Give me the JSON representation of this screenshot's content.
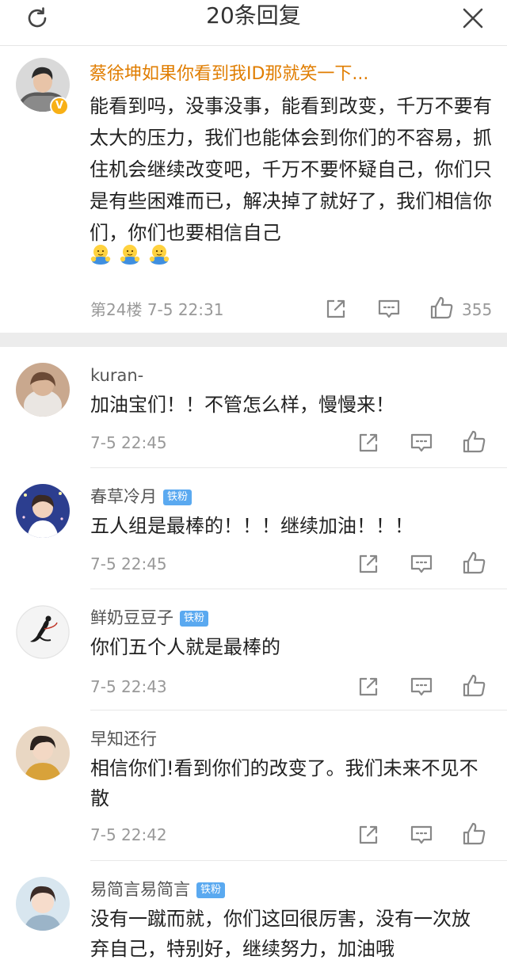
{
  "header": {
    "title": "20条回复"
  },
  "main_comment": {
    "username": "蔡徐坤如果你看到我ID那就笑一下...",
    "verified": "V",
    "text": "能看到吗，没事没事，能看到改变，千万不要有太大的压力，我们也能体会到你们的不容易，抓住机会继续改变吧，千万不要怀疑自己，你们只是有些困难而已，解决掉了就好了，我们相信你们，你们也要相信自己",
    "emojis": [
      "hug-emoji",
      "hug-emoji",
      "hug-emoji"
    ],
    "floor": "第24楼",
    "time": "7-5 22:31",
    "likes": "355"
  },
  "replies": [
    {
      "username": "kuran-",
      "badge": "",
      "text": "加油宝们！！不管怎么样，慢慢来！",
      "time": "7-5 22:45"
    },
    {
      "username": "春草冷月",
      "badge": "铁粉",
      "text": "五人组是最棒的！！！继续加油！！！",
      "time": "7-5 22:45"
    },
    {
      "username": "鲜奶豆豆子",
      "badge": "铁粉",
      "text": "你们五个人就是最棒的",
      "time": "7-5 22:43"
    },
    {
      "username": "早知还行",
      "badge": "",
      "text": "相信你们!看到你们的改变了。我们未来不见不散",
      "time": "7-5 22:42"
    },
    {
      "username": "易简言易简言",
      "badge": "铁粉",
      "text": "没有一蹴而就，你们这回很厉害，没有一次放弃自己，特别好，继续努力，加油哦",
      "time": ""
    }
  ],
  "icons": {
    "refresh": "refresh-icon",
    "close": "close-icon",
    "share": "share-icon",
    "comment": "comment-icon",
    "like": "like-icon"
  },
  "colors": {
    "username_main": "#e07d00",
    "badge": "#5aa9f0",
    "verified": "#f8b016",
    "meta": "#999999"
  }
}
